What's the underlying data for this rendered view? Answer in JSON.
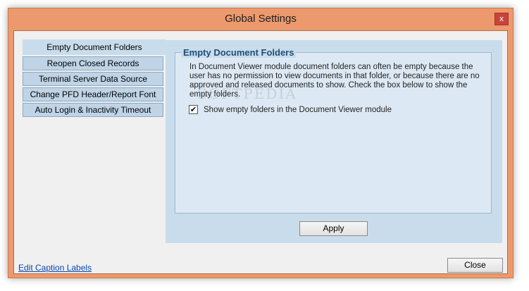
{
  "window": {
    "title": "Global Settings",
    "close_glyph": "x"
  },
  "sidebar": {
    "items": [
      {
        "label": "Empty Document Folders",
        "active": true
      },
      {
        "label": "Reopen Closed Records"
      },
      {
        "label": "Terminal Server Data Source"
      },
      {
        "label": "Change PFD Header/Report Font"
      },
      {
        "label": "Auto Login & Inactivity Timeout"
      }
    ]
  },
  "panel": {
    "group_title": "Empty Document Folders",
    "description": "In Document Viewer module document folders can often be empty because the user has no permission to view documents in that folder, or because there are no approved and released documents to show. Check the box below to show the empty folders.",
    "checkbox_label": "Show empty folders in the Document Viewer module",
    "checkbox_checked": true,
    "check_glyph": "✔",
    "apply_label": "Apply"
  },
  "footer": {
    "link_label": "Edit Caption Labels",
    "close_label": "Close"
  },
  "watermark": "SOFTPEDIA",
  "colors": {
    "frame": "#ec9a6d",
    "nav_bg": "#bfd4e6",
    "panel_bg": "#c9dceb",
    "group_title": "#1f4e79",
    "link": "#0645ad"
  }
}
